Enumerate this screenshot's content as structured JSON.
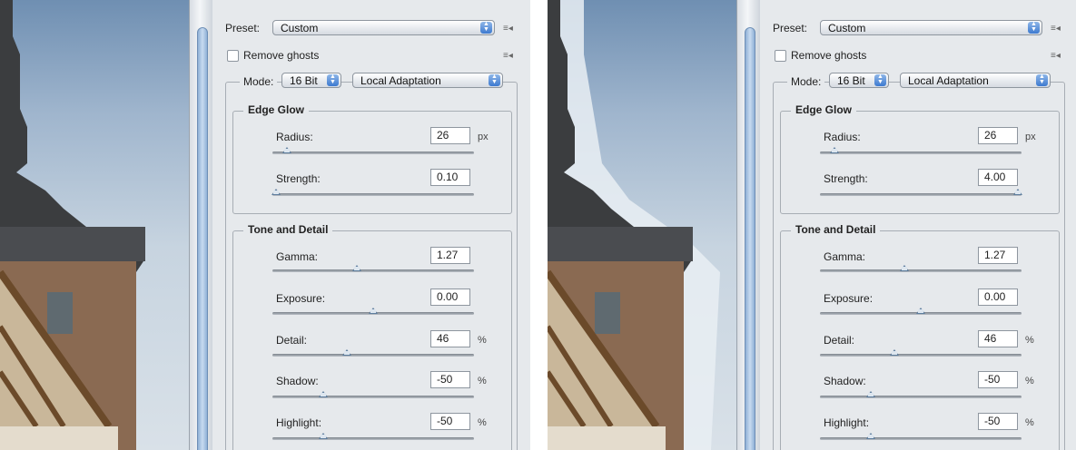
{
  "panels": [
    {
      "preset_label": "Preset:",
      "preset_value": "Custom",
      "remove_ghosts_label": "Remove ghosts",
      "mode_label": "Mode:",
      "bit_depth_value": "16 Bit",
      "method_value": "Local Adaptation",
      "edge_glow": {
        "title": "Edge Glow",
        "radius_label": "Radius:",
        "radius_value": "26",
        "radius_unit": "px",
        "radius_level": 0.07,
        "strength_label": "Strength:",
        "strength_value": "0.10",
        "strength_level": 0.02
      },
      "tone_detail": {
        "title": "Tone and Detail",
        "gamma_label": "Gamma:",
        "gamma_value": "1.27",
        "gamma_level": 0.42,
        "exposure_label": "Exposure:",
        "exposure_value": "0.00",
        "exposure_level": 0.5,
        "detail_label": "Detail:",
        "detail_value": "46",
        "detail_unit": "%",
        "detail_level": 0.37,
        "shadow_label": "Shadow:",
        "shadow_value": "-50",
        "shadow_unit": "%",
        "shadow_level": 0.25,
        "highlight_label": "Highlight:",
        "highlight_value": "-50",
        "highlight_unit": "%",
        "highlight_level": 0.25
      }
    },
    {
      "preset_label": "Preset:",
      "preset_value": "Custom",
      "remove_ghosts_label": "Remove ghosts",
      "mode_label": "Mode:",
      "bit_depth_value": "16 Bit",
      "method_value": "Local Adaptation",
      "edge_glow": {
        "title": "Edge Glow",
        "radius_label": "Radius:",
        "radius_value": "26",
        "radius_unit": "px",
        "radius_level": 0.07,
        "strength_label": "Strength:",
        "strength_value": "4.00",
        "strength_level": 0.98
      },
      "tone_detail": {
        "title": "Tone and Detail",
        "gamma_label": "Gamma:",
        "gamma_value": "1.27",
        "gamma_level": 0.42,
        "exposure_label": "Exposure:",
        "exposure_value": "0.00",
        "exposure_level": 0.5,
        "detail_label": "Detail:",
        "detail_value": "46",
        "detail_unit": "%",
        "detail_level": 0.37,
        "shadow_label": "Shadow:",
        "shadow_value": "-50",
        "shadow_unit": "%",
        "shadow_level": 0.25,
        "highlight_label": "Highlight:",
        "highlight_value": "-50",
        "highlight_unit": "%",
        "highlight_level": 0.25
      }
    }
  ],
  "icons": {
    "panel_menu": "panel-menu-icon",
    "dropdown": "dropdown-arrows-icon",
    "checkbox": "checkbox-icon"
  },
  "colors": {
    "panel_bg": "#e6e9ec",
    "thumb": "#5f7f9f",
    "select_arrow": "#3d7ad0"
  }
}
